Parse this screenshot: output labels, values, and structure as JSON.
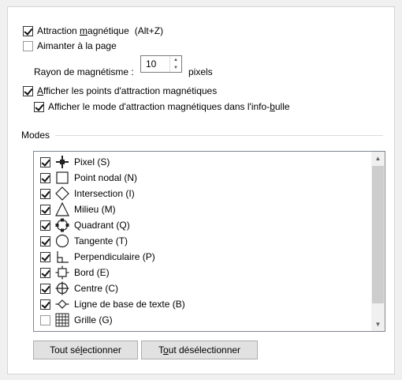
{
  "options": {
    "snap": {
      "pre": "Attraction ",
      "acc": "m",
      "post": "agnétique",
      "shortcut": "(Alt+Z)",
      "checked": true
    },
    "page": {
      "pre": "Aimanter à la pa",
      "acc": "g",
      "post": "e",
      "checked": false
    },
    "radius": {
      "pre": "Rayon de ma",
      "acc": "g",
      "post": "nétisme :",
      "value": "10",
      "unit": "pixels"
    },
    "show_points": {
      "pre": "",
      "acc": "A",
      "post": "fficher les points d'attraction magnétiques",
      "checked": true
    },
    "show_mode": {
      "pre": "Afficher le mode d'attraction magnétiques dans l'info-",
      "acc": "b",
      "post": "ulle",
      "checked": true
    }
  },
  "modes": {
    "label": "Modes",
    "items": [
      {
        "label": "Pixel (S)",
        "icon": "pixel-icon",
        "checked": true
      },
      {
        "label": "Point nodal (N)",
        "icon": "nodal-point-icon",
        "checked": true
      },
      {
        "label": "Intersection (I)",
        "icon": "intersection-icon",
        "checked": true
      },
      {
        "label": "Milieu (M)",
        "icon": "midpoint-icon",
        "checked": true
      },
      {
        "label": "Quadrant (Q)",
        "icon": "quadrant-icon",
        "checked": true
      },
      {
        "label": "Tangente (T)",
        "icon": "tangent-icon",
        "checked": true
      },
      {
        "label": "Perpendiculaire (P)",
        "icon": "perpendicular-icon",
        "checked": true
      },
      {
        "label": "Bord (E)",
        "icon": "edge-icon",
        "checked": true
      },
      {
        "label": "Centre (C)",
        "icon": "center-icon",
        "checked": true
      },
      {
        "label": "Ligne de base de texte (B)",
        "icon": "text-baseline-icon",
        "checked": true
      },
      {
        "label": "Grille (G)",
        "icon": "grid-icon",
        "checked": false
      }
    ]
  },
  "buttons": {
    "select_all": {
      "pre": "Tout sé",
      "acc": "l",
      "post": "ectionner"
    },
    "deselect_all": {
      "pre": "T",
      "acc": "o",
      "post": "ut désélectionner"
    }
  }
}
